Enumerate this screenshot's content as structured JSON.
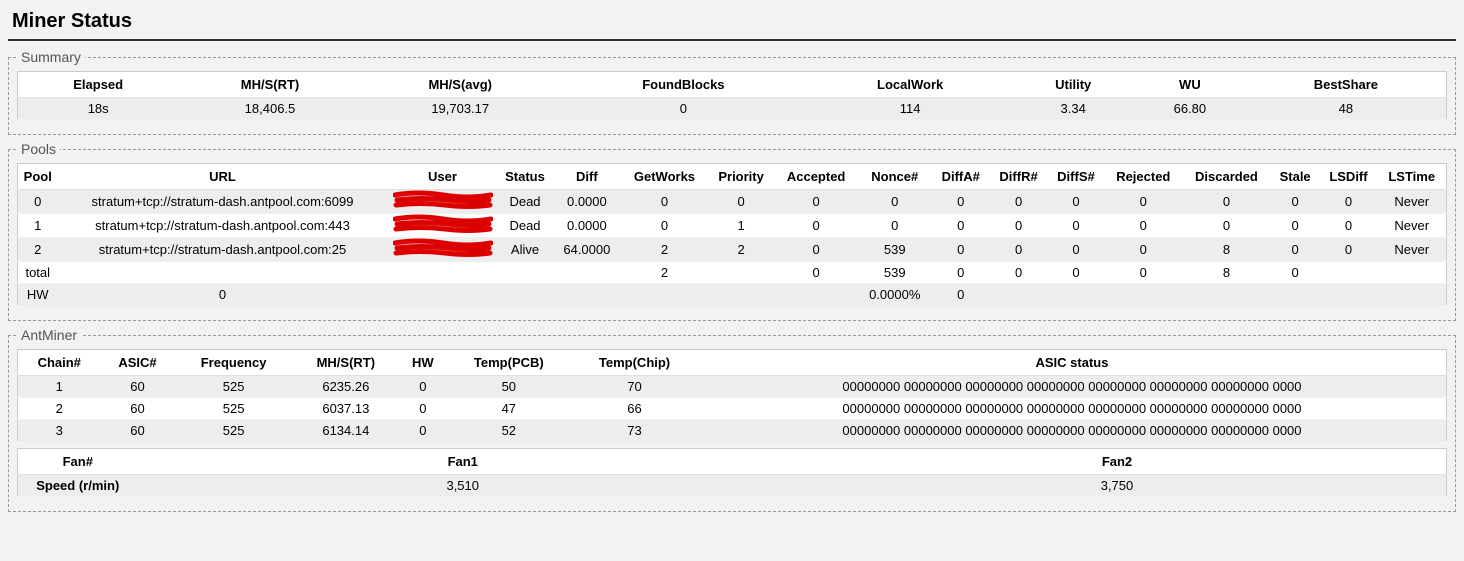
{
  "title": "Miner Status",
  "summary": {
    "legend": "Summary",
    "headers": [
      "Elapsed",
      "MH/S(RT)",
      "MH/S(avg)",
      "FoundBlocks",
      "LocalWork",
      "Utility",
      "WU",
      "BestShare"
    ],
    "row": [
      "18s",
      "18,406.5",
      "19,703.17",
      "0",
      "114",
      "3.34",
      "66.80",
      "48"
    ]
  },
  "pools": {
    "legend": "Pools",
    "headers": [
      "Pool",
      "URL",
      "User",
      "Status",
      "Diff",
      "GetWorks",
      "Priority",
      "Accepted",
      "Nonce#",
      "DiffA#",
      "DiffR#",
      "DiffS#",
      "Rejected",
      "Discarded",
      "Stale",
      "LSDiff",
      "LSTime"
    ],
    "rows": [
      [
        "0",
        "stratum+tcp://stratum-dash.antpool.com:6099",
        "__redacted__",
        "Dead",
        "0.0000",
        "0",
        "0",
        "0",
        "0",
        "0",
        "0",
        "0",
        "0",
        "0",
        "0",
        "0",
        "Never"
      ],
      [
        "1",
        "stratum+tcp://stratum-dash.antpool.com:443",
        "__redacted__",
        "Dead",
        "0.0000",
        "0",
        "1",
        "0",
        "0",
        "0",
        "0",
        "0",
        "0",
        "0",
        "0",
        "0",
        "Never"
      ],
      [
        "2",
        "stratum+tcp://stratum-dash.antpool.com:25",
        "__redacted__",
        "Alive",
        "64.0000",
        "2",
        "2",
        "0",
        "539",
        "0",
        "0",
        "0",
        "0",
        "8",
        "0",
        "0",
        "Never"
      ],
      [
        "total",
        "",
        "",
        "",
        "",
        "2",
        "",
        "0",
        "539",
        "0",
        "0",
        "0",
        "0",
        "8",
        "0",
        "",
        ""
      ],
      [
        "HW",
        "0",
        "",
        "",
        "",
        "",
        "",
        "",
        "0.0000%",
        "0",
        "",
        "",
        "",
        "",
        "",
        "",
        ""
      ]
    ]
  },
  "antminer": {
    "legend": "AntMiner",
    "chains": {
      "headers": [
        "Chain#",
        "ASIC#",
        "Frequency",
        "MH/S(RT)",
        "HW",
        "Temp(PCB)",
        "Temp(Chip)",
        "ASIC status"
      ],
      "rows": [
        [
          "1",
          "60",
          "525",
          "6235.26",
          "0",
          "50",
          "70",
          "00000000 00000000 00000000 00000000 00000000 00000000 00000000 0000"
        ],
        [
          "2",
          "60",
          "525",
          "6037.13",
          "0",
          "47",
          "66",
          "00000000 00000000 00000000 00000000 00000000 00000000 00000000 0000"
        ],
        [
          "3",
          "60",
          "525",
          "6134.14",
          "0",
          "52",
          "73",
          "00000000 00000000 00000000 00000000 00000000 00000000 00000000 0000"
        ]
      ]
    },
    "fans": {
      "header_label": "Fan#",
      "fan_cols": [
        "Fan1",
        "Fan2"
      ],
      "speed_label": "Speed (r/min)",
      "speeds": [
        "3,510",
        "3,750"
      ]
    }
  }
}
